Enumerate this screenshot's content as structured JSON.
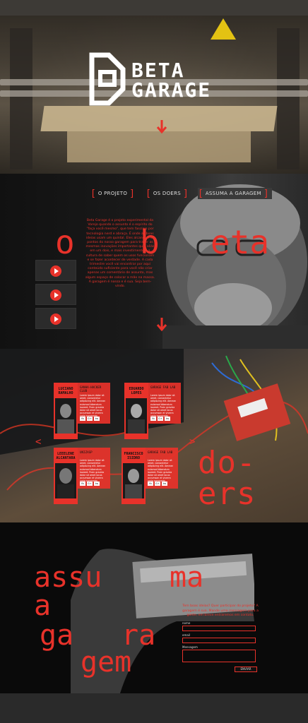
{
  "brand": {
    "line1": "BETA",
    "line2": "GARAGE"
  },
  "nav": [
    {
      "label": "O PROJETO"
    },
    {
      "label": "OS DOERS"
    },
    {
      "label": "ASSUMA A GARAGEM"
    }
  ],
  "obeta": {
    "words": [
      "o",
      "b",
      "eta"
    ],
    "text": "Beta Garage é o projeto experimental da Varejo quando o assunto é o espírito do \"faça você mesmo\", que tem fascínio por tecnologia nerd e abraça. É onde as boas ideias usam um quintal. Eles alcançam os pontos do nosso garagem para trazer as mesmas inovações importantes que, aliás em um dois, e mais investimento é a cultura de saber quem os usos funcionam e se fazer acontecer de verdade. A cada trimestre você vai encontrar por aqui conteúdo suficiente para você não criar apenas um comentário de assunto, mas algum espaço de colocar a mão na massa. A garagem é nossa e é sua. Seja bem-vindo."
  },
  "doers": {
    "word_line1": "do-",
    "word_line2": "ers",
    "members": [
      {
        "name": "LUCIANO RAMALHO",
        "role": "GANHA-HACKER CLUB",
        "bio": "Lorem ipsum dolor sit amet, consectetur adipiscing elit. Aenean euismod bibendum laoreet. Proin gravida dolor sit amet lacus accumsan et viverra justo commodo.",
        "social": [
          "fb",
          "G+",
          "tw"
        ]
      },
      {
        "name": "EDUARDO LOPES",
        "role": "GARAGE FAB LAB",
        "bio": "Lorem ipsum dolor sit amet, consectetur adipiscing elit. Aenean euismod bibendum laoreet. Proin gravida dolor sit amet lacus accumsan et viverra justo commodo.",
        "social": [
          "fb",
          "G+",
          "tw"
        ]
      },
      {
        "name": "LEEELENE ALCANTARA",
        "role": "UNIZASP",
        "bio": "Lorem ipsum dolor sit amet, consectetur adipiscing elit. Aenean euismod bibendum laoreet. Proin gravida dolor sit amet lacus accumsan et viverra justo commodo.",
        "social": [
          "fb",
          "G+",
          "tw"
        ]
      },
      {
        "name": "FRANCISCO ISIDRO",
        "role": "GARAGE FAB LAB",
        "bio": "Lorem ipsum dolor sit amet, consectetur adipiscing elit. Aenean euismod bibendum laoreet. Proin gravida dolor sit amet lacus accumsan et viverra justo commodo.",
        "social": [
          "fb",
          "G+",
          "tw"
        ]
      }
    ]
  },
  "assuma": {
    "words": [
      "assu",
      "ma",
      "a",
      "ga",
      "ra",
      "gem"
    ],
    "intro": "Tem boas ideias? Quer participar do projeto? A garagem é sua. Mande uma mensagem para a gente, em breve entraremos em contato.",
    "fields": {
      "name": "nome",
      "email": "email",
      "message": "Mensagem"
    },
    "send_label": "ENVIAR"
  },
  "colors": {
    "accent": "#e8322a",
    "dark": "#0c0c0c"
  }
}
